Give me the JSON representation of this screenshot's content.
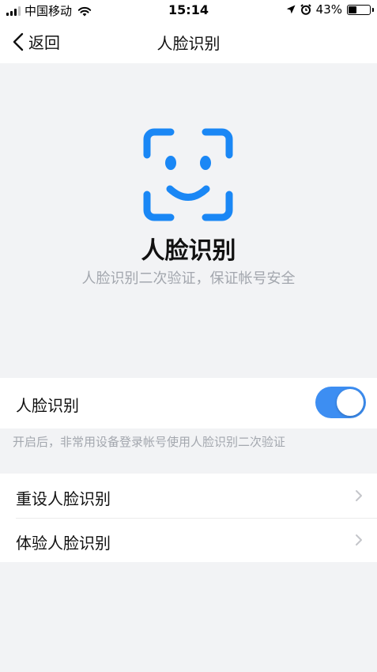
{
  "status_bar": {
    "carrier": "中国移动",
    "time": "15:14",
    "battery_text": "43%",
    "battery_level": 0.43
  },
  "nav": {
    "back_label": "返回",
    "title": "人脸识别"
  },
  "hero": {
    "icon": "face-recognition-icon",
    "title": "人脸识别",
    "subtitle": "人脸识别二次验证，保证帐号安全"
  },
  "toggle": {
    "label": "人脸识别",
    "enabled": true,
    "hint": "开启后，非常用设备登录帐号使用人脸识别二次验证"
  },
  "list": {
    "items": [
      {
        "label": "重设人脸识别"
      },
      {
        "label": "体验人脸识别"
      }
    ]
  },
  "colors": {
    "accent": "#3d8ef2",
    "icon_blue": "#1a87f5",
    "background": "#f2f3f5",
    "muted_text": "#a3a7ae"
  }
}
